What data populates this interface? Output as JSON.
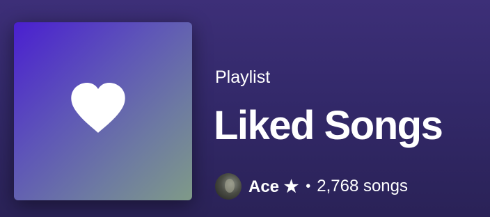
{
  "playlist": {
    "type_label": "Playlist",
    "title": "Liked Songs",
    "owner": "Ace ★",
    "separator": "•",
    "song_count": "2,768 songs",
    "cover_icon": "heart-icon",
    "avatar_icon": "user-avatar"
  },
  "colors": {
    "background": "#3d2f78",
    "cover_gradient_start": "#4a1fd0",
    "cover_gradient_end": "#7f9a88",
    "text": "#ffffff"
  }
}
